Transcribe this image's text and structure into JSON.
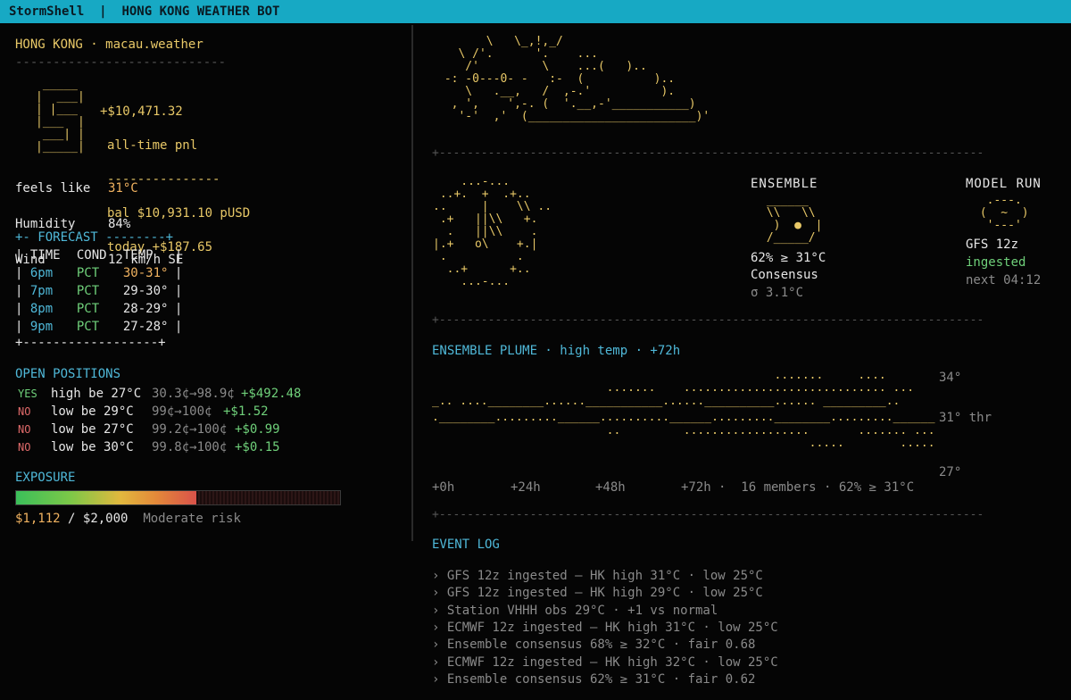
{
  "header": {
    "app": "StormShell",
    "sep": "|",
    "title": "HONG KONG WEATHER BOT"
  },
  "location": {
    "city": "HONG KONG",
    "sep": "·",
    "domain": "macau.weather",
    "rule": "----------------------------"
  },
  "logo_art": " _____\n|  ___|\n| |___\n|___  |\n ___| |\n|_____|",
  "pnl": {
    "total": "+$10,471.32",
    "total_label": "all-time pnl",
    "rule": "---------------",
    "balance": "bal $10,931.10 pUSD",
    "today": "today +$187.65"
  },
  "conditions": [
    {
      "label": "feels like",
      "value": "31°C"
    },
    {
      "label": "Humidity",
      "value": "84%"
    },
    {
      "label": "Wind",
      "value": "12 km/h SE"
    }
  ],
  "forecast": {
    "title_line": "+- FORECAST --------+",
    "headers": [
      "TIME",
      "COND",
      "TEMP"
    ],
    "rows": [
      {
        "time": "6pm",
        "cond": "PCT",
        "temp": "30-31°"
      },
      {
        "time": "7pm",
        "cond": "PCT",
        "temp": "29-30°"
      },
      {
        "time": "8pm",
        "cond": "PCT",
        "temp": "28-29°"
      },
      {
        "time": "9pm",
        "cond": "PCT",
        "temp": "27-28°"
      }
    ],
    "bottom_line": "+------------------+"
  },
  "positions": {
    "title": "OPEN POSITIONS",
    "items": [
      {
        "side": "YES",
        "desc": "high be 27°C",
        "price": "30.3¢→98.9¢",
        "pnl": "+$492.48",
        "color": "#6fd07a"
      },
      {
        "side": "NO",
        "desc": "low be 29°C",
        "price": "99¢→100¢",
        "pnl": "+$1.52",
        "color": "#e06a6a"
      },
      {
        "side": "NO",
        "desc": "low be 27°C",
        "price": "99.2¢→100¢",
        "pnl": "+$0.99",
        "color": "#e06a6a"
      },
      {
        "side": "NO",
        "desc": "low be 30°C",
        "price": "99.8¢→100¢",
        "pnl": "+$0.15",
        "color": "#e06a6a"
      }
    ]
  },
  "exposure": {
    "title": "EXPOSURE",
    "used": "$1,112",
    "sep": "/",
    "limit": "$2,000",
    "risk": "Moderate risk",
    "fraction": 0.556
  },
  "sun_cloud_art": "       \\   \\_,!,_/\n   \\ /'.      '.    ...\n    /'         \\    ...(   )..\n -: -0---0- -   :-  (          )..\n    \\   .__,   /  ,-.'          ).\n  , ',    ',-. (  '.__,-'___________)\n   '-'  ,'  (________________________)'",
  "sep_line": "+--------------------------------------------------------------------------------------+",
  "globe_art": "    ...-...\n ..+.  +  .+..\n..     |    \\\\ ..\n .+   ||\\\\   +.\n  .   ||\\\\    .\n|.+   o\\    +.|\n .          .\n  ..+      +..\n    ...-...",
  "ensemble": {
    "title": "ENSEMBLE",
    "art": " ______\n \\\\   \\\\\n  )  ●  |\n /_____/",
    "prob": "62% ≥ 31°C",
    "label": "Consensus",
    "sigma": "σ 3.1°C"
  },
  "model_run": {
    "title": "MODEL RUN",
    "art": "  .---.\n (  ~  )\n  '---'",
    "model": "GFS 12z",
    "status": "ingested",
    "next": "next 04:12"
  },
  "plume": {
    "title": "ENSEMBLE PLUME · high temp · +72h",
    "y_labels": [
      "34°",
      "31° thr",
      "27°"
    ],
    "x_labels": [
      "+0h",
      "+24h",
      "+48h",
      "+72h"
    ],
    "summary": "·  16 members · 62% ≥ 31°C",
    "rows": [
      "                                                 .......     ....",
      "                         .......    ............................. ...",
      "_.. ....________......___________......__________...... _________..",
      ".________.........______..........______.........________.........______",
      "                         ..         ..................       ....... ...",
      "                                                      .....        ....."
    ]
  },
  "event_log": {
    "title": "EVENT LOG",
    "lines": [
      "› GFS 12z ingested — HK high 31°C · low 25°C",
      "› GFS 12z ingested — HK high 29°C · low 25°C",
      "› Station VHHH obs 29°C · +1 vs normal",
      "› ECMWF 12z ingested — HK high 31°C · low 25°C",
      "› Ensemble consensus 68% ≥ 32°C · fair 0.68",
      "› ECMWF 12z ingested — HK high 32°C · low 25°C",
      "› Ensemble consensus 62% ≥ 31°C · fair 0.62"
    ]
  }
}
